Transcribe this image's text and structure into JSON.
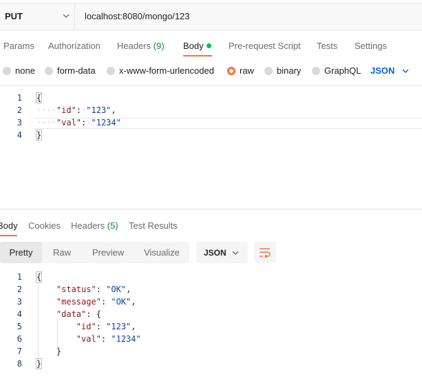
{
  "request": {
    "method": "PUT",
    "url": "localhost:8080/mongo/123"
  },
  "tabs": [
    {
      "label": "Params"
    },
    {
      "label": "Authorization"
    },
    {
      "label": "Headers",
      "count": "(9)"
    },
    {
      "label": "Body"
    },
    {
      "label": "Pre-request Script"
    },
    {
      "label": "Tests"
    },
    {
      "label": "Settings"
    }
  ],
  "body_types": [
    "none",
    "form-data",
    "x-www-form-urlencoded",
    "raw",
    "binary",
    "GraphQL"
  ],
  "body_format": "JSON",
  "request_body": {
    "line_numbers": [
      "1",
      "2",
      "3",
      "4"
    ],
    "open": "{",
    "id_key": "\"id\"",
    "id_val": "\"123\"",
    "val_key": "\"val\"",
    "val_val": "\"1234\"",
    "close": "}"
  },
  "response_tabs": [
    {
      "label": "Body"
    },
    {
      "label": "Cookies"
    },
    {
      "label": "Headers",
      "count": "(5)"
    },
    {
      "label": "Test Results"
    }
  ],
  "view_modes": [
    "Pretty",
    "Raw",
    "Preview",
    "Visualize"
  ],
  "response_format": "JSON",
  "response_body": {
    "line_numbers": [
      "1",
      "2",
      "3",
      "4",
      "5",
      "6",
      "7",
      "8"
    ],
    "open": "{",
    "status_key": "\"status\"",
    "status_val": "\"OK\"",
    "message_key": "\"message\"",
    "message_val": "\"OK\"",
    "data_key": "\"data\"",
    "data_open": "{",
    "id_key": "\"id\"",
    "id_val": "\"123\"",
    "val_key": "\"val\"",
    "val_val": "\"1234\"",
    "data_close": "}",
    "close": "}"
  },
  "icons": [
    "chevron-down-icon",
    "green-dot-icon",
    "wrap-lines-icon"
  ],
  "colors": {
    "accent": "#ff6c37",
    "link": "#0265d2",
    "count": "#0b8a3e",
    "dot": "#0cbb52"
  }
}
